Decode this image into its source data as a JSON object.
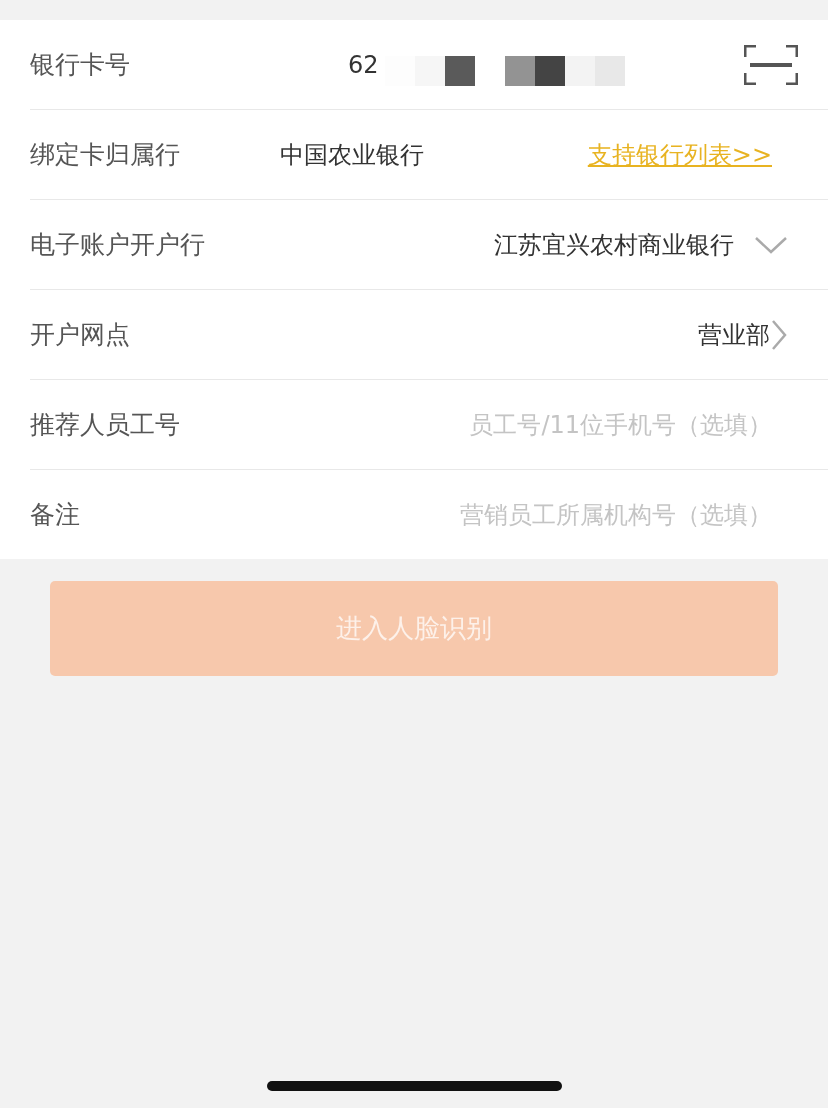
{
  "form": {
    "rows": [
      {
        "kind": "card",
        "label": "银行卡号",
        "value": "62"
      },
      {
        "kind": "bank",
        "label": "绑定卡归属行",
        "value": "中国农业银行",
        "link": "支持银行列表>>"
      },
      {
        "kind": "select",
        "label": "电子账户开户行",
        "value": "江苏宜兴农村商业银行"
      },
      {
        "kind": "nav",
        "label": "开户网点",
        "value": "营业部"
      },
      {
        "kind": "input",
        "label": "推荐人员工号",
        "placeholder": "员工号/11位手机号（选填）"
      },
      {
        "kind": "input",
        "label": "备注",
        "placeholder": "营销员工所属机构号（选填）"
      }
    ]
  },
  "submit_button": {
    "label": "进入人脸识别",
    "disabled": true
  }
}
